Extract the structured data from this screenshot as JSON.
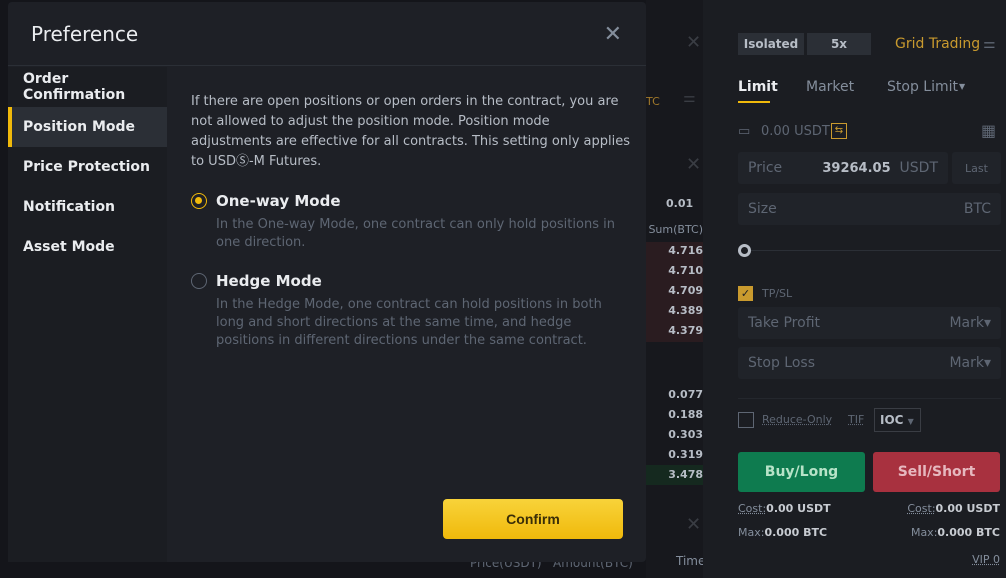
{
  "modal": {
    "title": "Preference",
    "sidebar": [
      {
        "label": "Order Confirmation",
        "active": false
      },
      {
        "label": "Position Mode",
        "active": true
      },
      {
        "label": "Price Protection",
        "active": false
      },
      {
        "label": "Notification",
        "active": false
      },
      {
        "label": "Asset Mode",
        "active": false
      }
    ],
    "description": "If there are open positions or open orders in the contract, you are not allowed to adjust the position mode. Position mode adjustments are effective for all contracts. This setting only applies to USDⓈ-M Futures.",
    "options": [
      {
        "label": "One-way Mode",
        "selected": true,
        "description": "In the One-way Mode, one contract can only hold positions in one direction."
      },
      {
        "label": "Hedge Mode",
        "selected": false,
        "description": "In the Hedge Mode, one contract can hold positions in both long and short directions at the same time, and hedge positions in different directions under the same contract."
      }
    ],
    "confirm_label": "Confirm"
  },
  "orderbook": {
    "tick": "0.01",
    "sum_header": "Sum(BTC)",
    "asks": [
      "4.716",
      "4.710",
      "4.709",
      "4.389",
      "4.379"
    ],
    "bids": [
      "0.077",
      "0.188",
      "0.303",
      "0.319",
      "3.478"
    ],
    "unit_fragment": "TC",
    "trades_headers": [
      "Price(USDT)",
      "Amount(BTC)",
      "Time"
    ]
  },
  "order_panel": {
    "margin_mode": "Isolated",
    "leverage": "5x",
    "grid_trading": "Grid Trading",
    "tabs": [
      "Limit",
      "Market",
      "Stop Limit"
    ],
    "active_tab": "Limit",
    "balance": "0.00 USDT",
    "price_label": "Price",
    "price_value": "39264.05",
    "price_unit": "USDT",
    "last_label": "Last",
    "size_label": "Size",
    "size_unit": "BTC",
    "tpsl_label": "TP/SL",
    "tpsl_checked": true,
    "take_profit": "Take Profit",
    "stop_loss": "Stop Loss",
    "mark": "Mark",
    "reduce_only": "Reduce-Only",
    "tif_label": "TIF",
    "tif_value": "IOC",
    "buy_label": "Buy/Long",
    "sell_label": "Sell/Short",
    "cost_label": "Cost:",
    "cost_buy": "0.00 USDT",
    "cost_sell": "0.00 USDT",
    "max_label": "Max:",
    "max_buy": "0.000 BTC",
    "max_sell": "0.000 BTC",
    "vip": "VIP 0",
    "colors": {
      "accent": "#f0b90b",
      "buy": "#0e7b4f",
      "sell": "#a8313f"
    }
  }
}
